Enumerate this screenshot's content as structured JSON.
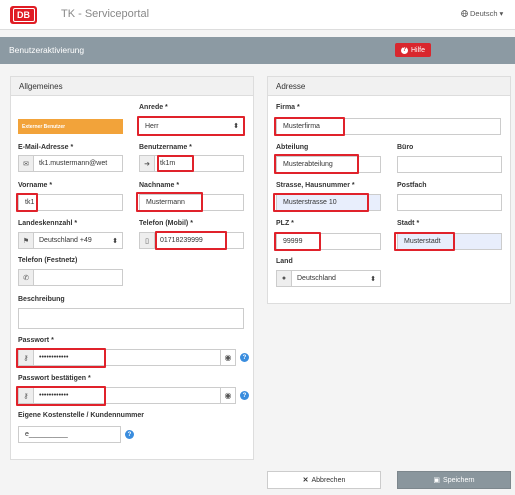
{
  "app": {
    "logo_text": "DB",
    "title": "TK - Serviceportal",
    "language": "Deutsch",
    "language_caret": "▾"
  },
  "header": {
    "title": "Benutzeraktivierung",
    "help_label": "Hilfe"
  },
  "general": {
    "heading": "Allgemeines",
    "badge": "Externer Benutzer",
    "anrede_label": "Anrede *",
    "anrede_value": "Herr",
    "email_label": "E-Mail-Adresse *",
    "email_value": "tk1.mustermann@wet",
    "username_label": "Benutzername *",
    "username_value": "tk1m",
    "firstname_label": "Vorname *",
    "firstname_value": "tk1",
    "lastname_label": "Nachname *",
    "lastname_value": "Mustermann",
    "country_code_label": "Landeskennzahl *",
    "country_code_value": "Deutschland +49",
    "mobile_label": "Telefon (Mobil) *",
    "mobile_value": "01718239999",
    "phone_label": "Telefon (Festnetz)",
    "phone_value": "",
    "description_label": "Beschreibung",
    "description_value": "",
    "password_label": "Passwort *",
    "password_value": "••••••••••••",
    "password_confirm_label": "Passwort bestätigen *",
    "password_confirm_value": "••••••••••••",
    "cost_center_label": "Eigene Kostenstelle / Kundennummer",
    "cost_center_value": "e__________"
  },
  "address": {
    "heading": "Adresse",
    "company_label": "Firma *",
    "company_value": "Musterfirma",
    "department_label": "Abteilung",
    "department_value": "Musterabteilung",
    "office_label": "Büro",
    "office_value": "",
    "street_label": "Strasse, Hausnummer *",
    "street_value": "Musterstrasse 10",
    "pobox_label": "Postfach",
    "pobox_value": "",
    "zip_label": "PLZ *",
    "zip_value": "99999",
    "city_label": "Stadt *",
    "city_value": "Musterstadt",
    "country_label": "Land",
    "country_value": "Deutschland"
  },
  "actions": {
    "cancel_label": "Abbrechen",
    "save_label": "Speichern"
  },
  "colors": {
    "brand_red": "#e01c24",
    "header_grey": "#8c9aa3",
    "highlight_red": "#e0222b",
    "badge_orange": "#f2a33a",
    "help_blue": "#3a8dde"
  }
}
